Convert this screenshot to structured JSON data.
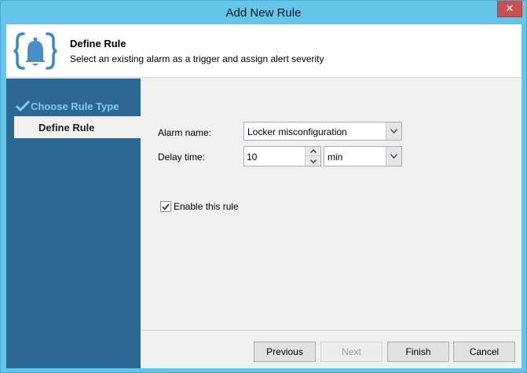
{
  "window": {
    "title": "Add New Rule",
    "close_label": "✕"
  },
  "header": {
    "title": "Define Rule",
    "description": "Select an existing alarm as a trigger and assign alert severity",
    "icon": "bell-icon"
  },
  "steps": [
    {
      "label": "Choose Rule Type",
      "state": "completed",
      "icon": "checkmark-icon"
    },
    {
      "label": "Define Rule",
      "state": "current"
    }
  ],
  "form": {
    "alarm_name_label": "Alarm name:",
    "alarm_name_value": "Locker misconfiguration",
    "delay_time_label": "Delay time:",
    "delay_time_value": "10",
    "delay_unit_value": "min",
    "enable_rule_label": "Enable this rule",
    "enable_rule_checked": true
  },
  "buttons": {
    "previous": "Previous",
    "next": "Next",
    "finish": "Finish",
    "cancel": "Cancel"
  },
  "colors": {
    "titlebar": "#63c5ea",
    "sidebar": "#2d6894",
    "completed_step": "#7ecaf0",
    "close_button": "#c75050"
  }
}
